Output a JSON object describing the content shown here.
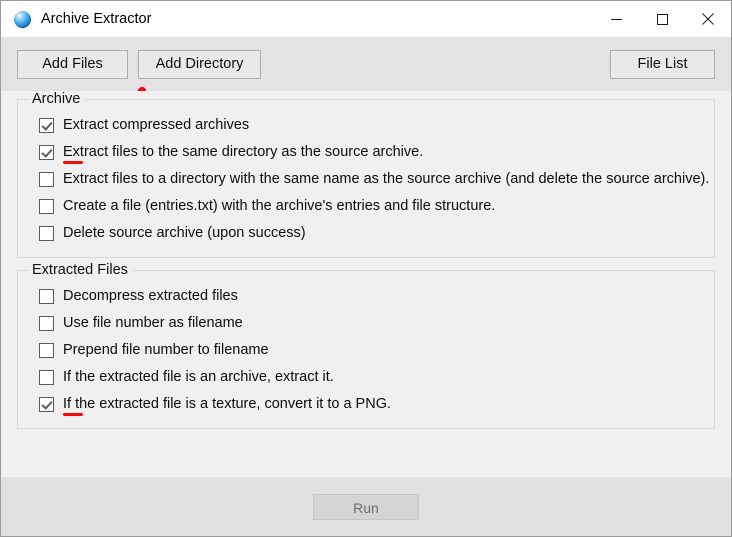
{
  "window": {
    "title": "Archive Extractor",
    "icon": "blue-sphere-icon",
    "controls": {
      "minimize": "minimize-icon",
      "maximize": "maximize-icon",
      "close": "close-icon"
    }
  },
  "toolbar": {
    "add_files_label": "Add Files",
    "add_directory_label": "Add Directory",
    "file_list_label": "File List"
  },
  "groups": [
    {
      "title": "Archive",
      "items": [
        {
          "label": "Extract compressed archives",
          "checked": true,
          "annotated": false
        },
        {
          "label": "Extract files to the same directory as the source archive.",
          "checked": true,
          "annotated": true
        },
        {
          "label": "Extract files to a directory with the same name as the source archive (and delete the source archive).",
          "checked": false,
          "annotated": false
        },
        {
          "label": "Create a file (entries.txt) with the archive's entries and file structure.",
          "checked": false,
          "annotated": false
        },
        {
          "label": "Delete source archive (upon success)",
          "checked": false,
          "annotated": false
        }
      ]
    },
    {
      "title": "Extracted Files",
      "items": [
        {
          "label": "Decompress extracted files",
          "checked": false,
          "annotated": false
        },
        {
          "label": "Use file number as filename",
          "checked": false,
          "annotated": false
        },
        {
          "label": "Prepend file number to filename",
          "checked": false,
          "annotated": false
        },
        {
          "label": "If the extracted file is an archive, extract it.",
          "checked": false,
          "annotated": false
        },
        {
          "label": "If the extracted file is a texture, convert it to a PNG.",
          "checked": true,
          "annotated": true
        }
      ]
    }
  ],
  "footer": {
    "run_label": "Run",
    "run_enabled": false
  },
  "annotation_color": "#f50a0a"
}
